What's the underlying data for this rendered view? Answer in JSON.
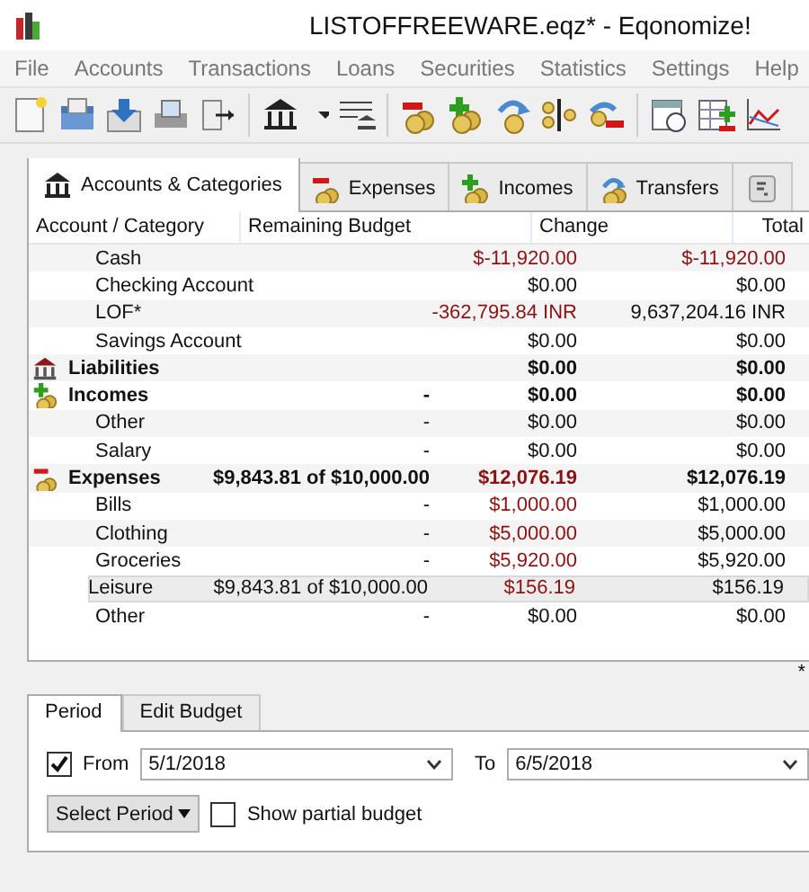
{
  "window": {
    "title": "LISTOFFREEWARE.eqz* - Eqonomize!"
  },
  "menu": [
    "File",
    "Accounts",
    "Transactions",
    "Loans",
    "Securities",
    "Statistics",
    "Settings",
    "Help"
  ],
  "tabs": [
    {
      "label": "Accounts & Categories",
      "kind": "bank",
      "selected": true
    },
    {
      "label": "Expenses",
      "kind": "expense",
      "selected": false
    },
    {
      "label": "Incomes",
      "kind": "income",
      "selected": false
    },
    {
      "label": "Transfers",
      "kind": "transfer",
      "selected": false
    },
    {
      "kind": "currency",
      "selected": false
    }
  ],
  "table": {
    "columns": [
      "Account / Category",
      "Remaining Budget",
      "Change",
      "Total"
    ],
    "rows": [
      {
        "kind": "account",
        "name": "Cash",
        "change": "$-11,920.00",
        "total": "$-11,920.00",
        "change_red": true,
        "total_red": true,
        "selected": false
      },
      {
        "kind": "account",
        "name": "Checking Account",
        "change": "$0.00",
        "total": "$0.00",
        "change_red": false,
        "total_red": false,
        "selected": false
      },
      {
        "kind": "account",
        "name": "LOF*",
        "change": "-362,795.84 INR",
        "total": "9,637,204.16 INR",
        "change_red": true,
        "total_red": false,
        "selected": false
      },
      {
        "kind": "account",
        "name": "Savings Account",
        "change": "$0.00",
        "total": "$0.00",
        "change_red": false,
        "total_red": false,
        "selected": false
      },
      {
        "kind": "liability-group",
        "name": "Liabilities",
        "change": "$0.00",
        "total": "$0.00",
        "change_red": false,
        "total_red": false,
        "selected": false
      },
      {
        "kind": "income-group",
        "name": "Incomes",
        "budget": "-",
        "change": "$0.00",
        "total": "$0.00",
        "change_red": false,
        "total_red": false,
        "selected": false
      },
      {
        "kind": "category",
        "name": "Other",
        "budget": "-",
        "change": "$0.00",
        "total": "$0.00",
        "change_red": false,
        "total_red": false,
        "selected": false
      },
      {
        "kind": "category",
        "name": "Salary",
        "budget": "-",
        "change": "$0.00",
        "total": "$0.00",
        "change_red": false,
        "total_red": false,
        "selected": false
      },
      {
        "kind": "expense-group",
        "name": "Expenses",
        "budget": "$9,843.81 of $10,000.00",
        "change": "$12,076.19",
        "total": "$12,076.19",
        "change_red": true,
        "total_red": false,
        "selected": false
      },
      {
        "kind": "category",
        "name": "Bills",
        "budget": "-",
        "change": "$1,000.00",
        "total": "$1,000.00",
        "change_red": true,
        "total_red": false,
        "selected": false
      },
      {
        "kind": "category",
        "name": "Clothing",
        "budget": "-",
        "change": "$5,000.00",
        "total": "$5,000.00",
        "change_red": true,
        "total_red": false,
        "selected": false
      },
      {
        "kind": "category",
        "name": "Groceries",
        "budget": "-",
        "change": "$5,920.00",
        "total": "$5,920.00",
        "change_red": true,
        "total_red": false,
        "selected": false
      },
      {
        "kind": "category",
        "name": "Leisure",
        "budget": "$9,843.81 of $10,000.00",
        "change": "$156.19",
        "total": "$156.19",
        "change_red": true,
        "total_red": false,
        "selected": true
      },
      {
        "kind": "category",
        "name": "Other",
        "budget": "-",
        "change": "$0.00",
        "total": "$0.00",
        "change_red": false,
        "total_red": false,
        "selected": false
      }
    ]
  },
  "modified_mark": "*",
  "bottom_tabs": [
    {
      "label": "Period",
      "selected": true
    },
    {
      "label": "Edit Budget",
      "selected": false
    }
  ],
  "period": {
    "from_label": "From",
    "from_checked": true,
    "from": "5/1/2018",
    "to_label": "To",
    "to": "6/5/2018",
    "select_button": "Select Period",
    "partial_label": "Show partial budget",
    "partial_checked": false
  }
}
